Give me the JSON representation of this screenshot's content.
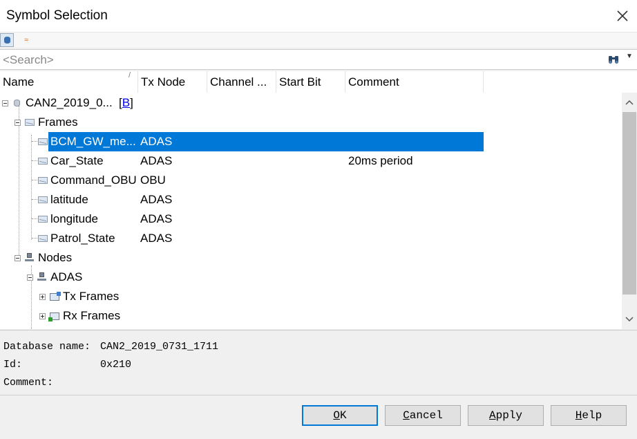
{
  "window": {
    "title": "Symbol Selection"
  },
  "search": {
    "placeholder": "<Search>",
    "value": ""
  },
  "columns": [
    "Name",
    "Tx Node",
    "Channel ...",
    "Start Bit",
    "Comment"
  ],
  "tree": {
    "database": {
      "label": "CAN2_2019_0...",
      "badge": "B"
    },
    "frames_label": "Frames",
    "frames": [
      {
        "name": "BCM_GW_me...",
        "tx_node": "ADAS",
        "comment": "",
        "selected": true
      },
      {
        "name": "Car_State",
        "tx_node": "ADAS",
        "comment": "20ms period"
      },
      {
        "name": "Command_OBU",
        "tx_node": "OBU",
        "comment": ""
      },
      {
        "name": "latitude",
        "tx_node": "ADAS",
        "comment": ""
      },
      {
        "name": "longitude",
        "tx_node": "ADAS",
        "comment": ""
      },
      {
        "name": "Patrol_State",
        "tx_node": "ADAS",
        "comment": ""
      }
    ],
    "nodes_label": "Nodes",
    "node_adas": "ADAS",
    "tx_frames_label": "Tx Frames",
    "rx_frames_label": "Rx Frames"
  },
  "info": {
    "db_label": "Database name:",
    "db_value": "CAN2_2019_0731_1711",
    "id_label": "Id:",
    "id_value": "0x210",
    "comment_label": "Comment:",
    "comment_value": ""
  },
  "buttons": {
    "ok": {
      "acc": "O",
      "rest": "K"
    },
    "cancel": {
      "acc": "C",
      "rest": "ancel"
    },
    "apply": {
      "acc": "A",
      "rest": "pply"
    },
    "help": {
      "acc": "H",
      "rest": "elp"
    }
  },
  "icons": {
    "close": "close-icon",
    "find": "binoculars-icon",
    "database": "database-icon",
    "frame": "frame-icon",
    "node": "node-icon"
  },
  "colors": {
    "selection": "#0078d7",
    "link": "#0000ee"
  }
}
